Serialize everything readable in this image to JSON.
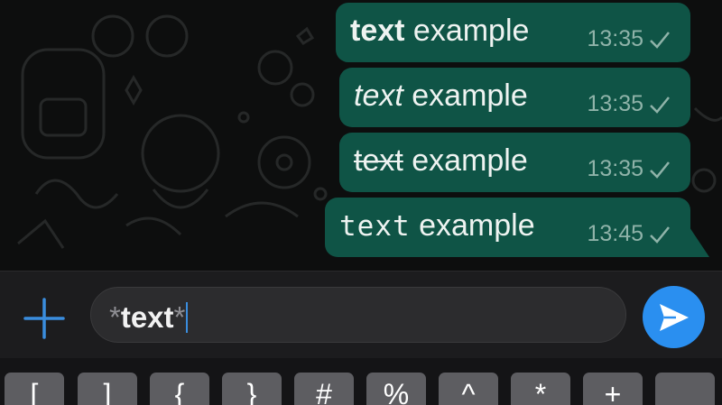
{
  "messages": [
    {
      "text_main": "text",
      "text_rest": " example",
      "style": "bold",
      "time": "13:35"
    },
    {
      "text_main": "text",
      "text_rest": " example",
      "style": "italic",
      "time": "13:35"
    },
    {
      "text_main": "text",
      "text_rest": " example",
      "style": "strikethrough",
      "time": "13:35"
    },
    {
      "text_main": "text",
      "text_rest": " example",
      "style": "monospace",
      "time": "13:45"
    }
  ],
  "composer": {
    "input_prefix": "*",
    "input_word": "text",
    "input_suffix": "*"
  },
  "keyboard": {
    "keys": [
      "[",
      "]",
      "{",
      "}",
      "#",
      "%",
      "^",
      "*",
      "+",
      ""
    ]
  },
  "colors": {
    "bubble": "#0f5446",
    "send": "#2a8ff0",
    "accent": "#3a8dde"
  },
  "icons": {
    "add": "plus-icon",
    "send": "send-arrow-icon",
    "status": "checkmark-icon"
  }
}
